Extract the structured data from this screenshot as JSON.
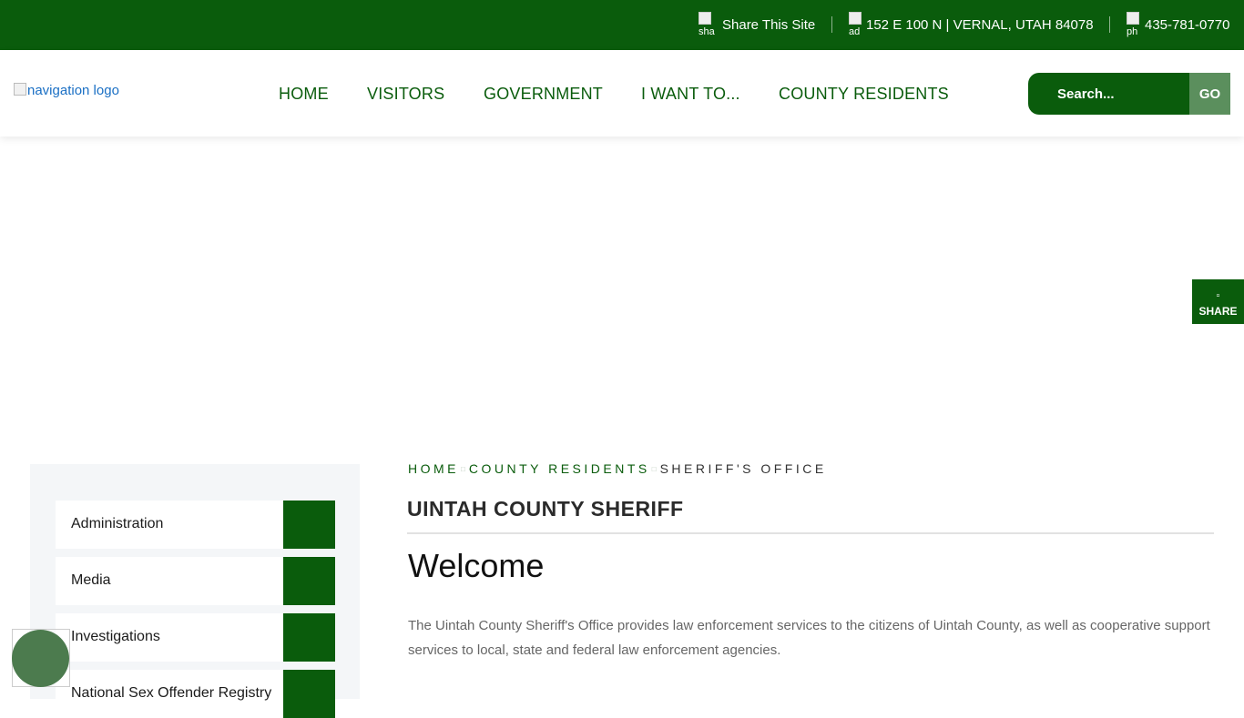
{
  "topbar": {
    "share_icon_alt": "share",
    "share_label": "Share This Site",
    "address_icon_alt": "address",
    "address": "152 E 100 N | VERNAL, UTAH 84078",
    "phone_icon_alt": "phone",
    "phone": "435-781-0770",
    "background_color": "#0a5c0c"
  },
  "header": {
    "logo_alt": "navigation logo",
    "nav": {
      "home": "HOME",
      "visitors": "VISITORS",
      "government": "GOVERNMENT",
      "i_want_to": "I WANT TO...",
      "county_residents": "COUNTY RESIDENTS"
    },
    "search": {
      "placeholder": "Search...",
      "button": "GO"
    }
  },
  "share_tab": {
    "icon": "share-icon",
    "label": "SHARE"
  },
  "sidebar": {
    "items": [
      {
        "label": "Administration"
      },
      {
        "label": "Media"
      },
      {
        "label": "Investigations"
      },
      {
        "label": "National Sex Offender Registry"
      }
    ]
  },
  "main": {
    "breadcrumb": {
      "home": "HOME",
      "county_residents": "COUNTY RESIDENTS",
      "current": "SHERIFF'S OFFICE"
    },
    "page_title": "UINTAH COUNTY SHERIFF",
    "heading": "Welcome",
    "body": "The Uintah County Sheriff's Office provides law enforcement services to the citizens of Uintah County, as well as cooperative support services to local, state and federal law enforcement agencies."
  },
  "colors": {
    "brand_green": "#0a5c0c",
    "go_button": "#5b8f5d",
    "accessibility_button": "#4c7b4e"
  }
}
